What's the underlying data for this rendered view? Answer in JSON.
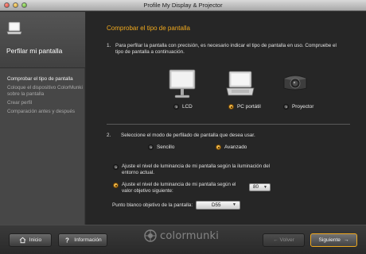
{
  "window": {
    "title": "Profile My Display & Projector"
  },
  "sidebar": {
    "title": "Perfilar mi pantalla",
    "items": [
      {
        "label": "Comprobar el tipo de pantalla"
      },
      {
        "label": "Coloque el dispositivo ColorMunki sobre la pantalla"
      },
      {
        "label": "Crear perfil"
      },
      {
        "label": "Comparación antes y después"
      }
    ]
  },
  "main": {
    "section_title": "Comprobar el tipo de pantalla",
    "step1": {
      "number": "1.",
      "text": "Para perfilar la pantalla con precisión, es necesario indicar el tipo de pantalla en uso. Compruebe el tipo de pantalla a continuación."
    },
    "display_types": [
      {
        "label": "LCD",
        "selected": false,
        "icon": "lcd-monitor-icon"
      },
      {
        "label": "PC portátil",
        "selected": true,
        "icon": "laptop-icon"
      },
      {
        "label": "Proyector",
        "selected": false,
        "icon": "projector-icon"
      }
    ],
    "step2": {
      "number": "2.",
      "text": "Seleccione el modo de perfilado de pantalla que desea usar."
    },
    "modes": [
      {
        "label": "Sencillo",
        "selected": false
      },
      {
        "label": "Avanzado",
        "selected": true
      }
    ],
    "luminance_options": [
      {
        "label": "Ajuste el nivel de luminancia de mi pantalla según la iluminación del entorno actual.",
        "selected": false
      },
      {
        "label": "Ajuste el nivel de luminancia de mi pantalla según el valor objetivo siguiente:",
        "selected": true
      }
    ],
    "luminance_value": "80",
    "white_point_label": "Punto blanco objetivo de la pantalla:",
    "white_point_value": "D55"
  },
  "footer": {
    "home_label": "Inicio",
    "info_label": "Información",
    "logo_text": "colormunki",
    "back_label": "← Volver",
    "next_label": "Siguiente",
    "accent": "#f0a91e"
  }
}
